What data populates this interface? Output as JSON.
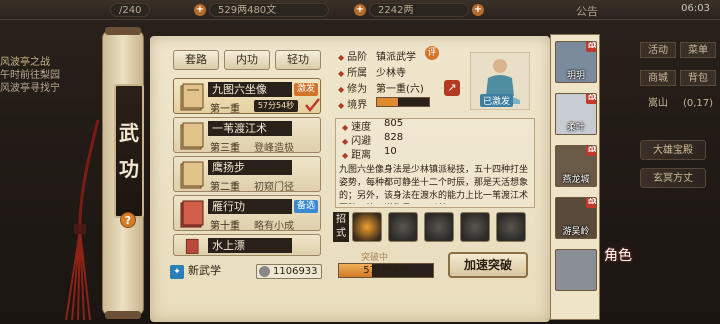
{
  "topbar": {
    "energy": "/240",
    "silver": "529两480文",
    "gold": "2242两",
    "announcement": "公告",
    "time": "06:03"
  },
  "quest": {
    "title": "风波亭之战",
    "line1": "午时前往梨园",
    "line2": "风波亭寻找宁"
  },
  "right_menu": {
    "b1": "活动",
    "b2": "菜单",
    "b3": "商城",
    "b4": "背包",
    "b5": "嵩山",
    "b6": "(0,17)",
    "pill1": "大雄宝殿",
    "pill2": "玄冥方丈"
  },
  "scroll_title": {
    "c1": "武",
    "c2": "功",
    "help": "?"
  },
  "tabs": {
    "t1": "套路",
    "t2": "内功",
    "t3": "轻功"
  },
  "skills": [
    {
      "name": "九图六坐像",
      "level": "第一重",
      "timer": "57分54秒",
      "badge": "激发"
    },
    {
      "name": "一苇渡江术",
      "level": "第三重",
      "rank": "登峰造极"
    },
    {
      "name": "鹰扬步",
      "level": "第二重",
      "rank": "初窥门径"
    },
    {
      "name": "雁行功",
      "level": "第十重",
      "rank": "略有小成",
      "badge": "备选"
    },
    {
      "name": "水上漂"
    }
  ],
  "detail": {
    "grade_label": "品阶",
    "grade": "镇派武学",
    "grade_tag": "评",
    "sect_label": "所属",
    "sect": "少林寺",
    "cultivation_label": "修为",
    "cultivation": "第一重(六)",
    "realm_label": "境界",
    "realm_fill": 0.4,
    "activated": "已激发",
    "speed_label": "速度",
    "speed": "805",
    "dodge_label": "闪避",
    "dodge": "828",
    "distance_label": "距离",
    "distance": "10",
    "description": "九图六坐像身法是少林镇派秘技，五十四种打坐姿势，每种都可静坐十二个时辰，那是天活想象的；另外，该身法在渡水的能力上比一苇渡江术更胜一筹，堪称最……以茶"
  },
  "moves_label": "招式",
  "breakthrough": {
    "label": "突破中",
    "timer": "57分54秒",
    "progress": 0.35,
    "button": "加速突破"
  },
  "new_skill": "新武学",
  "coins": "1106933",
  "team": [
    {
      "name": "玥玥",
      "tag": "战"
    },
    {
      "name": "柔叶",
      "tag": "战"
    },
    {
      "name": "燕龙城",
      "tag": "战"
    },
    {
      "name": "游吴岭",
      "tag": "战"
    },
    {
      "name": "",
      "tag": ""
    }
  ],
  "juese": "角色",
  "colors": {
    "accent": "#b23b22",
    "paper": "#efe6cd",
    "ink": "#2a211a",
    "progress": "#cf7a26"
  }
}
